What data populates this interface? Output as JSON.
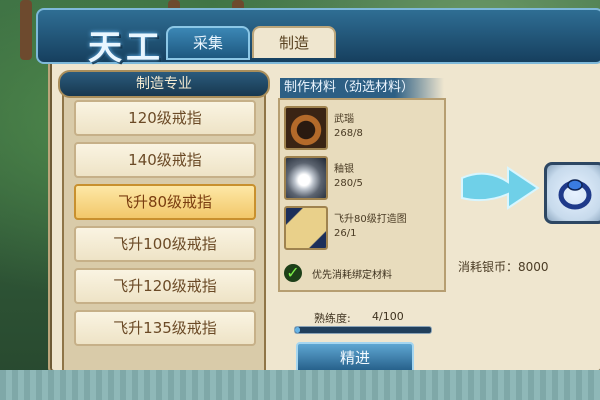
{
  "window": {
    "logo": "天工",
    "tabs": [
      {
        "label": "采集",
        "active": false
      },
      {
        "label": "制造",
        "active": true
      }
    ]
  },
  "recipe_list": {
    "header": "制造专业",
    "items": [
      {
        "label": "120级戒指",
        "selected": false
      },
      {
        "label": "140级戒指",
        "selected": false
      },
      {
        "label": "飞升80级戒指",
        "selected": true
      },
      {
        "label": "飞升100级戒指",
        "selected": false
      },
      {
        "label": "飞升120级戒指",
        "selected": false
      },
      {
        "label": "飞升135级戒指",
        "selected": false
      }
    ]
  },
  "materials": {
    "header": "制作材料（劲选材料）",
    "items": [
      {
        "name": "武瑙",
        "count": "268/8",
        "icon": "ring-band-icon"
      },
      {
        "name": "釉银",
        "count": "280/5",
        "icon": "silver-ore-icon"
      },
      {
        "name": "飞升80级打造图",
        "count": "26/1",
        "icon": "scroll-icon"
      }
    ],
    "prefer_bound_label": "优先消耗绑定材料",
    "prefer_bound_checked": true
  },
  "proficiency": {
    "label": "熟练度:",
    "value": "4/100",
    "fraction": 0.04
  },
  "refine_button": "精进",
  "cost_text": "消耗银币：8000",
  "colors": {
    "accent_blue": "#2d5f84",
    "selected_item": "#f2c86a",
    "panel_bg": "#efe6cf"
  }
}
